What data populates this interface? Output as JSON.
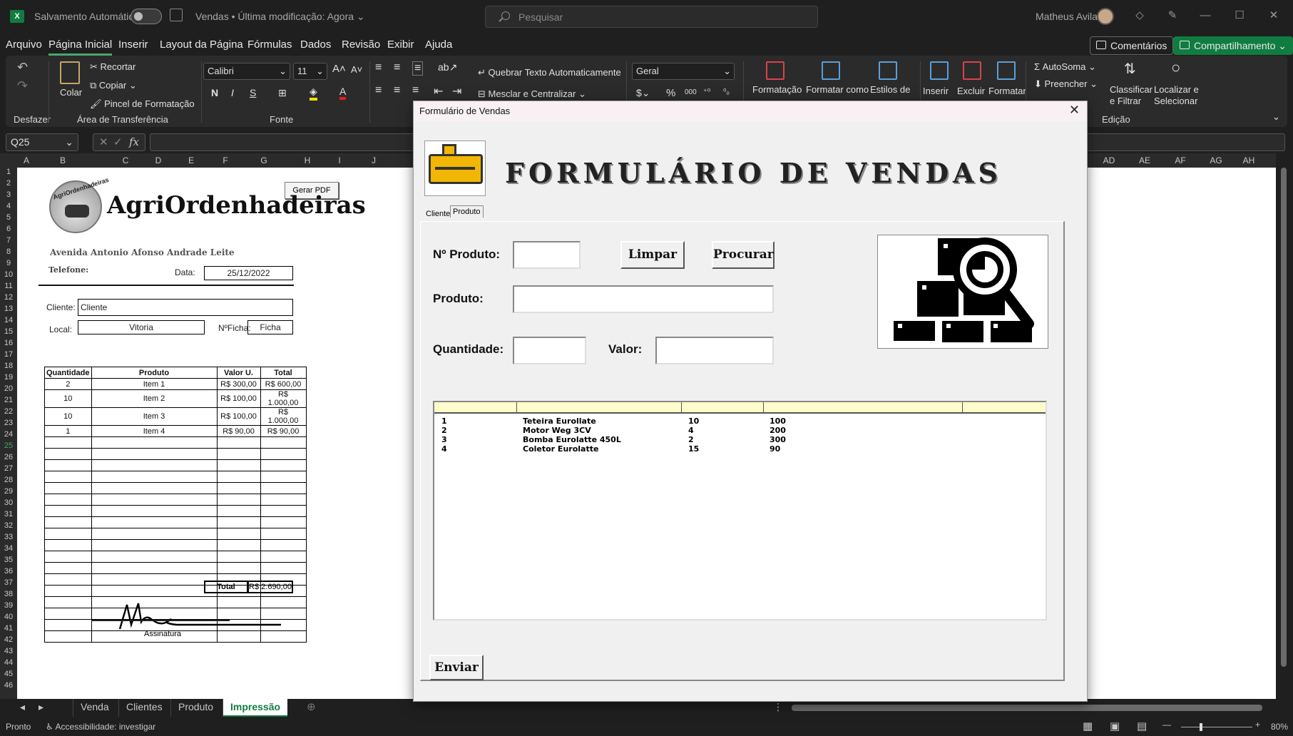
{
  "titlebar": {
    "app_icon": "X",
    "autosave_label": "Salvamento Automático",
    "doc_title": "Vendas • Última modificação: Agora",
    "search_placeholder": "Pesquisar",
    "user_name": "Matheus Avila"
  },
  "menu": {
    "items": [
      "Arquivo",
      "Página Inicial",
      "Inserir",
      "Layout da Página",
      "Fórmulas",
      "Dados",
      "Revisão",
      "Exibir",
      "Ajuda"
    ],
    "comments_label": "Comentários",
    "share_label": "Compartilhamento"
  },
  "ribbon": {
    "undo_group": "Desfazer",
    "paste_label": "Colar",
    "cut_label": "Recortar",
    "copy_label": "Copiar",
    "format_painter_label": "Pincel de Formatação",
    "clipboard_group": "Área de Transferência",
    "font_name": "Calibri",
    "font_size": "11",
    "font_group": "Fonte",
    "wrap_text_label": "Quebrar Texto Automaticamente",
    "merge_center_label": "Mesclar e Centralizar",
    "number_format": "Geral",
    "conditional_label": "Formatação",
    "format_table_label": "Formatar como",
    "cell_styles_label": "Estilos de",
    "insert_label": "Inserir",
    "delete_label": "Excluir",
    "format_label": "Formatar",
    "autosum_label": "AutoSoma",
    "fill_label": "Preencher",
    "sort_label": "Classificar",
    "sort_label2": "e Filtrar",
    "find_label": "Localizar e",
    "find_label2": "Selecionar",
    "edit_group": "Edição"
  },
  "formula_bar": {
    "name_box": "Q25",
    "fx": "fx",
    "content": ""
  },
  "columns": [
    "A",
    "B",
    "C",
    "D",
    "E",
    "F",
    "G",
    "H",
    "I",
    "J"
  ],
  "columns_right": [
    "AD",
    "AE",
    "AF",
    "AG",
    "AH"
  ],
  "rows": [
    "1",
    "2",
    "3",
    "4",
    "5",
    "6",
    "7",
    "8",
    "9",
    "10",
    "11",
    "12",
    "13",
    "14",
    "15",
    "16",
    "17",
    "18",
    "19",
    "20",
    "21",
    "22",
    "23",
    "24",
    "25",
    "26",
    "27",
    "28",
    "29",
    "30",
    "31",
    "32",
    "33",
    "34",
    "35",
    "36",
    "37",
    "38",
    "39",
    "40",
    "41",
    "42",
    "43",
    "44",
    "45",
    "46"
  ],
  "sheet": {
    "pdf_button": "Gerar PDF",
    "company": "AgriOrdenhadeiras",
    "logo_text": "AgriOrdenhadeiras",
    "address": "Avenida Antonio Afonso Andrade Leite",
    "phone_label": "Telefone:",
    "date_label": "Data:",
    "date_value": "25/12/2022",
    "client_label": "Cliente:",
    "client_value": "Cliente",
    "local_label": "Local:",
    "local_value": "Vitoria",
    "ficha_label": "NºFicha:",
    "ficha_value": "Ficha",
    "table_headers": [
      "Quantidade",
      "Produto",
      "Valor U.",
      "Total"
    ],
    "table_rows": [
      [
        "2",
        "Item 1",
        "R$ 300,00",
        "R$ 600,00"
      ],
      [
        "10",
        "Item 2",
        "R$ 100,00",
        "R$ 1.000,00"
      ],
      [
        "10",
        "Item 3",
        "R$ 100,00",
        "R$ 1.000,00"
      ],
      [
        "1",
        "Item 4",
        "R$ 90,00",
        "R$ 90,00"
      ]
    ],
    "total_label": "Total",
    "total_value": "R$ 2.690,00",
    "signature_label": "Assinatura"
  },
  "sheet_tabs": [
    "Venda",
    "Clientes",
    "Produto",
    "Impressão"
  ],
  "active_tab": "Impressão",
  "status": {
    "ready": "Pronto",
    "accessibility": "Accessibilidade: investigar",
    "zoom": "80%"
  },
  "dialog": {
    "title": "Formulário de Vendas",
    "heading": "FORMULÁRIO DE VENDAS",
    "tabs": [
      "Cliente",
      "Produto"
    ],
    "product_no_label": "Nº Produto:",
    "clear_button": "Limpar",
    "search_button": "Procurar",
    "product_label": "Produto:",
    "quantity_label": "Quantidade:",
    "value_label": "Valor:",
    "list_rows": [
      [
        "1",
        "Teteira Eurollate",
        "10",
        "100"
      ],
      [
        "2",
        "Motor Weg 3CV",
        "4",
        "200"
      ],
      [
        "3",
        "Bomba Eurolatte 450L",
        "2",
        "300"
      ],
      [
        "4",
        "Coletor Eurolatte",
        "15",
        "90"
      ]
    ],
    "send_button": "Enviar"
  }
}
